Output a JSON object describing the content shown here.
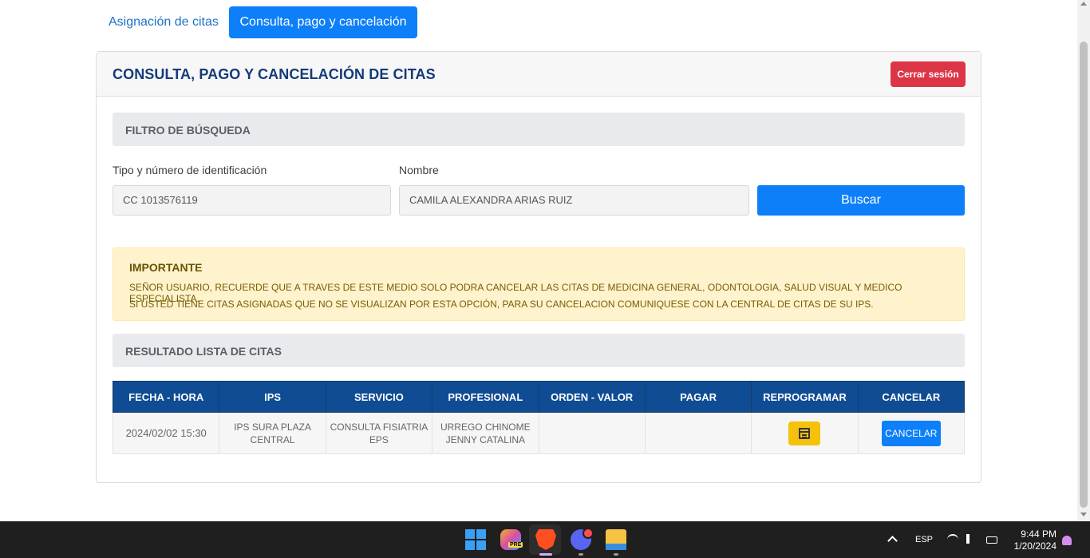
{
  "tabs": [
    {
      "label": "Asignación de citas",
      "active": false
    },
    {
      "label": "Consulta, pago y cancelación",
      "active": true
    }
  ],
  "card": {
    "title": "CONSULTA, PAGO Y CANCELACIÓN DE CITAS",
    "logout_label": "Cerrar sesión"
  },
  "filter": {
    "section_title": "FILTRO DE BÚSQUEDA",
    "id_label": "Tipo y número de identificación",
    "id_value": "CC 1013576119",
    "name_label": "Nombre",
    "name_value": "CAMILA ALEXANDRA ARIAS RUIZ",
    "search_label": "Buscar"
  },
  "alert": {
    "title": "IMPORTANTE",
    "line1": "SEÑOR USUARIO, RECUERDE QUE A TRAVES DE ESTE MEDIO SOLO PODRA CANCELAR LAS CITAS DE MEDICINA GENERAL, ODONTOLOGIA, SALUD VISUAL Y MEDICO ESPECIALISTA.",
    "line2": "SI USTED TIENE CITAS ASIGNADAS QUE NO SE VISUALIZAN POR ESTA OPCIÓN, PARA SU CANCELACION COMUNIQUESE CON LA CENTRAL DE CITAS DE SU IPS."
  },
  "results": {
    "section_title": "RESULTADO LISTA DE CITAS",
    "columns": [
      "FECHA - HORA",
      "IPS",
      "SERVICIO",
      "PROFESIONAL",
      "ORDEN - VALOR",
      "PAGAR",
      "REPROGRAMAR",
      "CANCELAR"
    ],
    "rows": [
      {
        "fecha_hora": "2024/02/02 15:30",
        "ips": "IPS SURA PLAZA CENTRAL",
        "servicio": "CONSULTA FISIATRIA EPS",
        "profesional": "URREGO CHINOME JENNY CATALINA",
        "orden_valor": "",
        "pagar": "",
        "reprogramar_icon": "calendar-icon",
        "cancelar_label": "CANCELAR"
      }
    ]
  },
  "taskbar": {
    "copilot_badge": "PRE",
    "language": "ESP",
    "time": "9:44 PM",
    "date": "1/20/2024"
  },
  "colors": {
    "primary": "#0d7ff9",
    "danger": "#dc3545",
    "table_header": "#0f4c93",
    "warning_bg": "#fff3cd",
    "calendar_button": "#f5c10a"
  }
}
